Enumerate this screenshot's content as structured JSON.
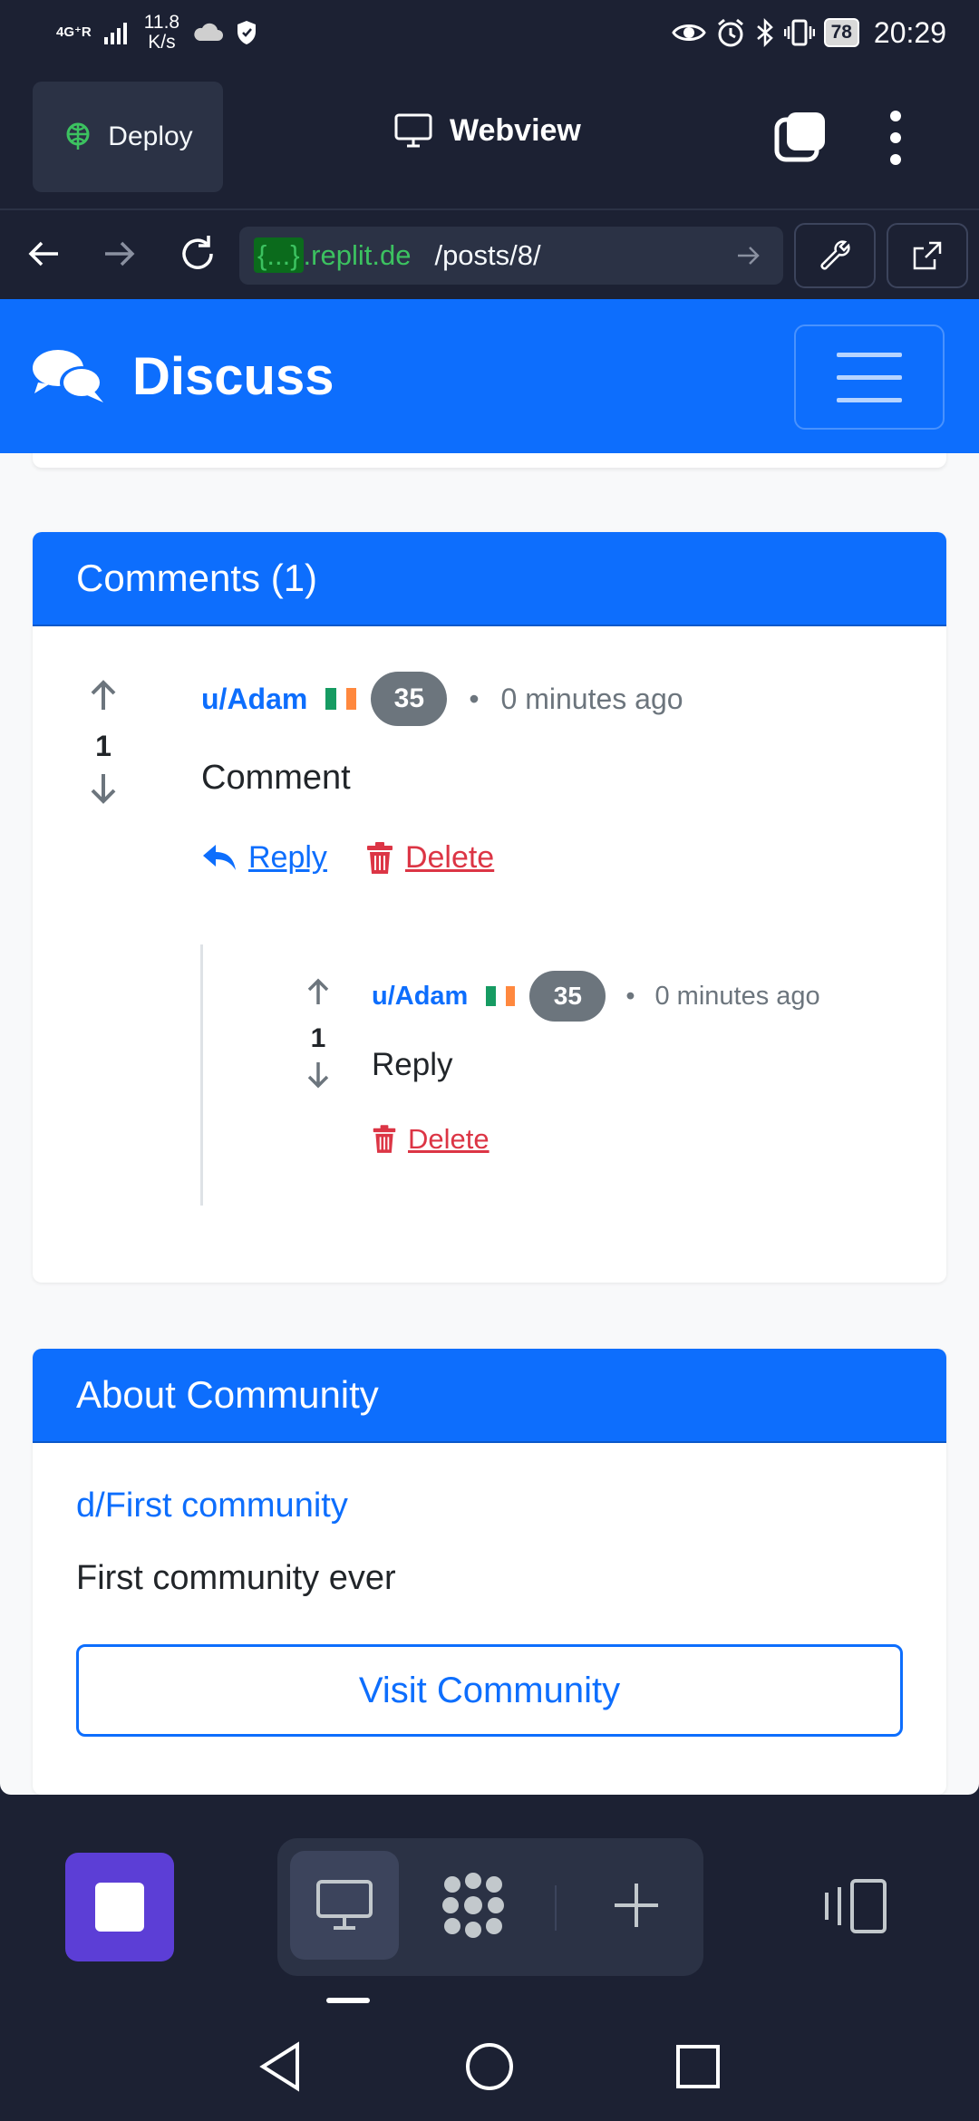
{
  "status_bar": {
    "network": "4G⁺R",
    "speed_value": "11.8",
    "speed_unit": "K/s",
    "battery": "78",
    "time": "20:29"
  },
  "topbar": {
    "deploy_label": "Deploy",
    "webview_label": "Webview"
  },
  "urlbar": {
    "host_brace": "{...}",
    "host_rest": ".replit.de",
    "path": "/posts/8/"
  },
  "site": {
    "brand": "Discuss"
  },
  "comments": {
    "header": "Comments (1)",
    "comment": {
      "votes": "1",
      "user": "u/Adam",
      "karma": "35",
      "time": "0 minutes ago",
      "body": "Comment",
      "reply_label": " Reply ",
      "delete_label": " Delete"
    },
    "reply": {
      "votes": "1",
      "user": "u/Adam",
      "karma": "35",
      "time": "0 minutes ago",
      "body": "Reply",
      "delete_label": " Delete"
    },
    "separator": "•"
  },
  "about": {
    "header": "About Community",
    "community_name": "d/First community",
    "description": "First community ever",
    "visit_label": "Visit Community"
  },
  "colors": {
    "primary": "#0d6efd",
    "danger": "#dc3545",
    "secondary": "#6c757d",
    "replit_bg": "#1c2133",
    "replit_accent": "#5c3ed6"
  }
}
